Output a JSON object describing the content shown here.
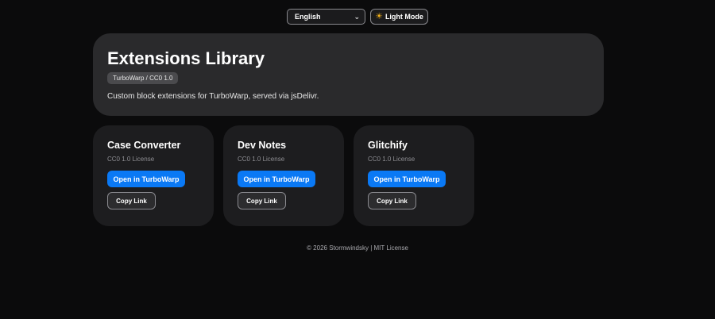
{
  "topbar": {
    "language_selected": "English",
    "mode_icon": "sun-icon",
    "mode_label": "Light Mode"
  },
  "hero": {
    "title": "Extensions Library",
    "badge": "TurboWarp / CC0 1.0",
    "description": "Custom block extensions for TurboWarp, served via jsDelivr."
  },
  "cards": [
    {
      "title": "Case Converter",
      "license": "CC0 1.0 License",
      "open_label": "Open in TurboWarp",
      "copy_label": "Copy Link"
    },
    {
      "title": "Dev Notes",
      "license": "CC0 1.0 License",
      "open_label": "Open in TurboWarp",
      "copy_label": "Copy Link"
    },
    {
      "title": "Glitchify",
      "license": "CC0 1.0 License",
      "open_label": "Open in TurboWarp",
      "copy_label": "Copy Link"
    }
  ],
  "footer": {
    "text": "© 2026 Stormwindsky | MIT License"
  },
  "colors": {
    "background": "#0b0b0c",
    "hero_panel": "#2a2a2c",
    "card": "#1d1d1f",
    "primary_button": "#0a79f5",
    "sun": "#f5b21a"
  }
}
